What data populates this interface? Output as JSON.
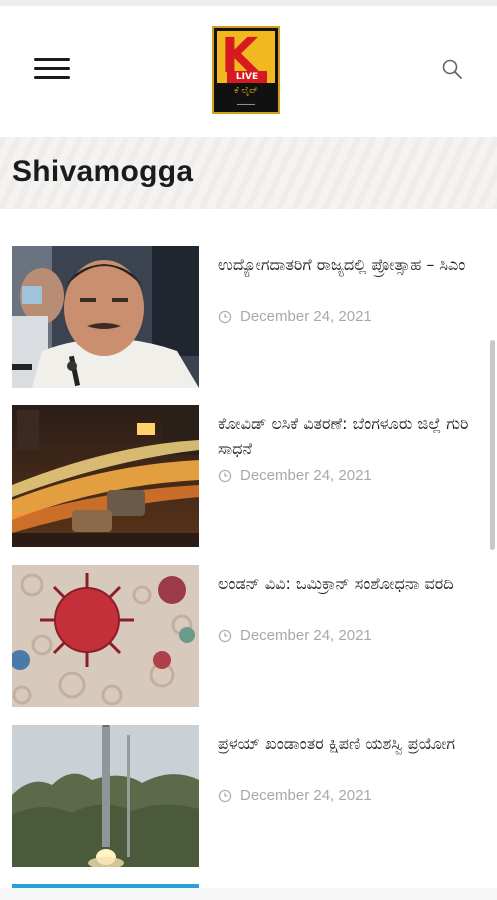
{
  "header": {
    "menu_icon": "hamburger-menu-icon",
    "search_icon": "search-icon",
    "logo": {
      "letter": "K",
      "badge": "LIVE",
      "kannada_text": "ಕೆ ಲೈವ್"
    }
  },
  "page": {
    "title": "Shivamogga"
  },
  "articles": [
    {
      "title": "ಉದ್ಯೋಗದಾತರಿಗೆ ರಾಜ್ಯದಲ್ಲಿ ಪ್ರೋತ್ಸಾಹ – ಸಿಎಂ",
      "date": "December 24, 2021",
      "image": "man-at-microphone"
    },
    {
      "title": "ಕೋವಿಡ್ ಲಸಿಕೆ ವಿತರಣೆ: ಬೆಂಗಳೂರು ಜಿಲ್ಲೆ ಗುರಿ ಸಾಧನೆ",
      "date": "December 24, 2021",
      "image": "city-traffic-night"
    },
    {
      "title": "ಲಂಡನ್ ವಿವಿ: ಒಮಿಕ್ರಾನ್ ಸಂಶೋಧನಾ ವರದಿ",
      "date": "December 24, 2021",
      "image": "coronavirus-illustration"
    },
    {
      "title": "ಪ್ರಳಯ್ ಖಂಡಾಂತರ ಕ್ಷಿಪಣಿ ಯಶಸ್ವಿ ಪ್ರಯೋಗ",
      "date": "December 24, 2021",
      "image": "missile-launch"
    }
  ],
  "colors": {
    "accent_blue": "#2aa0d8",
    "logo_yellow": "#f2b820",
    "logo_red": "#d71920",
    "date_gray": "#a8a8a8"
  }
}
